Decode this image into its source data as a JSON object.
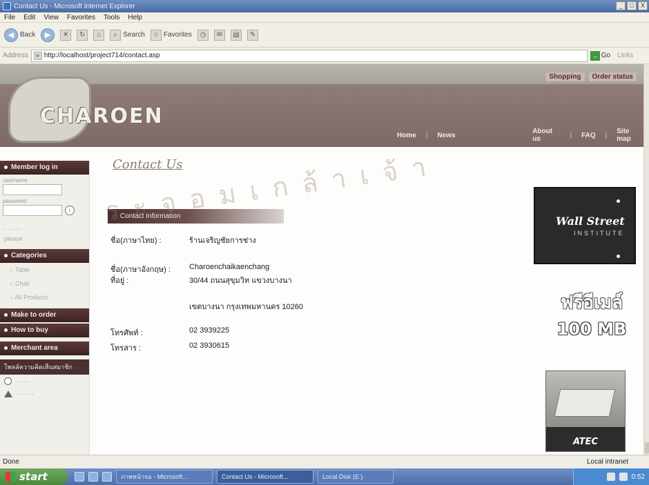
{
  "window": {
    "title": "Contact Us - Microsoft Internet Explorer",
    "minimize": "_",
    "maximize": "□",
    "close": "X"
  },
  "menu": [
    "File",
    "Edit",
    "View",
    "Favorites",
    "Tools",
    "Help"
  ],
  "toolbar": {
    "back_label": "Back",
    "search_label": "Search",
    "favorites_label": "Favorites"
  },
  "address": {
    "label": "Address",
    "url": "http://localhost/project714/contact.asp",
    "go_label": "Go",
    "links_label": "Links"
  },
  "site": {
    "util_links": [
      "Shopping",
      "Order status"
    ],
    "logo_text": "CHAROEN",
    "nav": [
      "Home",
      "News",
      "About us",
      "FAQ",
      "Site map"
    ]
  },
  "sidebar": {
    "member_head": "Member log in",
    "username_label": "username",
    "password_label": "password",
    "go_symbol": "›",
    "register_text": "- - - - -",
    "register_sub": "please",
    "categories_head": "Categories",
    "categories": [
      "Table",
      "Chair",
      "All Products"
    ],
    "make_to_order": "Make to order",
    "how_to_buy": "How to buy",
    "merchant_area": "Merchant area",
    "poll_head": "โพลล์ความคิดเห็นสมาชิก"
  },
  "content": {
    "title": "Contact Us",
    "box_label": "Contact Information",
    "rows": [
      {
        "k": "ชื่อ(ภาษาไทย)    :",
        "v": "ร้านเจริญชัยการช่าง"
      },
      {
        "k": "ชื่อ(ภาษาอังกฤษ) :",
        "v": "Charoenchaikaenchang"
      },
      {
        "k": "ที่อยู่ :",
        "v": "30/44 ถนนสุขุมวิท แขวงบางนา"
      },
      {
        "k": "",
        "v": "เขตบางนา กรุงเทพมหานคร 10260"
      },
      {
        "k": "โทรศัพท์ :",
        "v": "02 3939225"
      },
      {
        "k": "โทรสาร :",
        "v": "02 3930615"
      }
    ]
  },
  "ads": {
    "wsi_line1": "Wall Street",
    "wsi_line2": "INSTITUTE",
    "free_line1": "ฟรีอีเมล์",
    "free_line2": "100 MB",
    "atec_brand": "ATEC"
  },
  "status": {
    "left": "Done",
    "right": "Local intranet"
  },
  "taskbar": {
    "start": "start",
    "items": [
      "ภาพหน้าจอ - Microsoft...",
      "Contact Us - Microsoft...",
      "Local Disk (E:)"
    ],
    "time": "0:52"
  }
}
